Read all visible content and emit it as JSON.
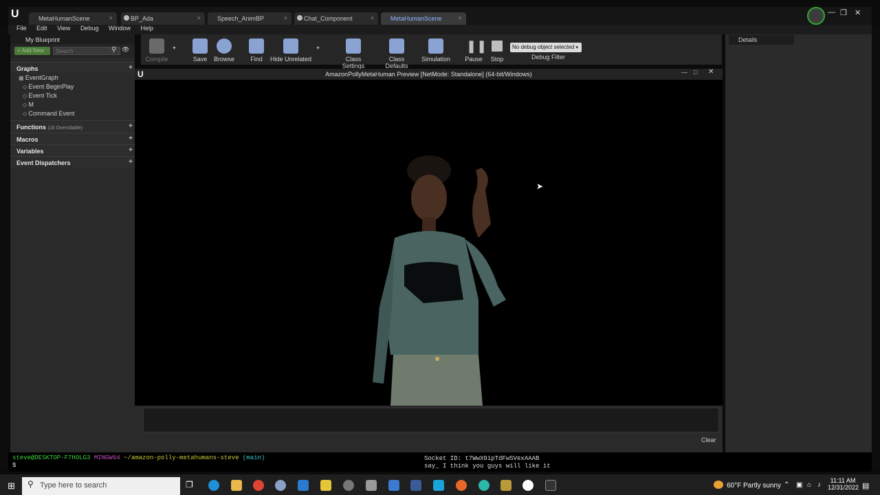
{
  "tabs": [
    {
      "label": "MetaHumanScene",
      "active": false
    },
    {
      "label": "BP_Ada",
      "active": false
    },
    {
      "label": "Speech_AnimBP",
      "active": false
    },
    {
      "label": "Chat_Component",
      "active": false
    },
    {
      "label": "MetaHumanScene",
      "active": true
    }
  ],
  "menu": [
    "File",
    "Edit",
    "View",
    "Debug",
    "Window",
    "Help"
  ],
  "left_panel": {
    "header": "My Blueprint",
    "add_new": "+ Add New",
    "search_placeholder": "Search",
    "sections": {
      "graphs": "Graphs",
      "functions": "Functions",
      "functions_count": "(18 Overridable)",
      "macros": "Macros",
      "variables": "Variables",
      "dispatchers": "Event Dispatchers"
    },
    "graph_root": "EventGraph",
    "graph_items": [
      "Event BeginPlay",
      "Event Tick",
      "M",
      "Command Event"
    ]
  },
  "toolbar": {
    "compile": "Compile",
    "save": "Save",
    "browse": "Browse",
    "find": "Find",
    "hide_unrelated": "Hide Unrelated",
    "class_settings": "Class Settings",
    "class_defaults": "Class Defaults",
    "simulation": "Simulation",
    "pause": "Pause",
    "stop": "Stop",
    "debug_object": "No debug object selected",
    "debug_filter": "Debug Filter"
  },
  "preview": {
    "title": "AmazonPollyMetaHuman Preview [NetMode: Standalone]  (64-bit/Windows)"
  },
  "details": {
    "tab": "Details"
  },
  "output": {
    "clear": "Clear"
  },
  "terminal": {
    "prompt_user": "steve@DESKTOP-F7HOLG3",
    "prompt_env": "MINGW64",
    "prompt_path": "~/amazon-polly-metahumans-steve",
    "prompt_branch": "(main)",
    "prompt_symbol": "$",
    "socket_line": "Socket ID:  t7WwX0ipTdFwSVexAAAB",
    "say_line": "say_ I think you guys will like it"
  },
  "taskbar": {
    "search_placeholder": "Type here to search",
    "weather": "60°F  Partly sunny",
    "time": "11:11 AM",
    "date": "12/31/2022"
  },
  "colors": {
    "accent": "#8fb3ff",
    "terminal_green": "#3fd33f",
    "terminal_magenta": "#c34fc3",
    "terminal_yellow": "#c8c83a",
    "terminal_cyan": "#3ac8c8"
  }
}
